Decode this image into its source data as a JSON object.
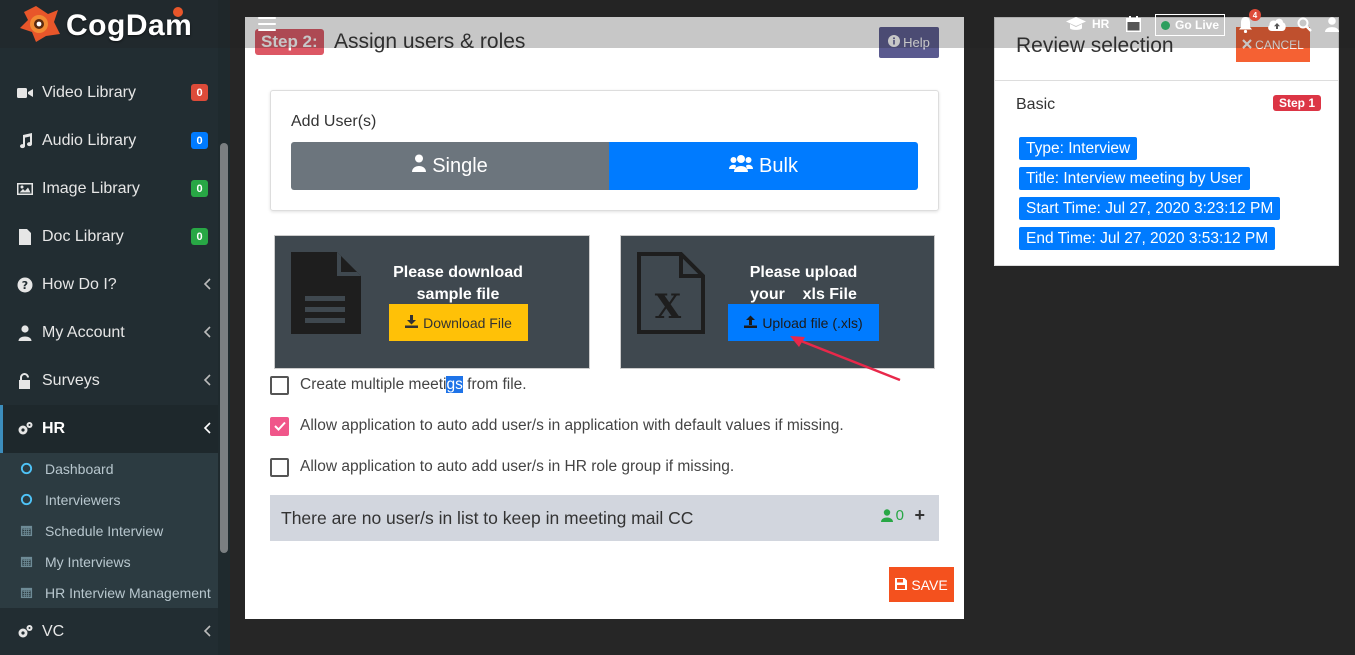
{
  "brand": {
    "logo_cog": "Cog",
    "logo_dam": "Dam"
  },
  "topbar": {
    "role_label": "HR",
    "golive_label": "Go Live",
    "notification_count": "4"
  },
  "sidebar": {
    "items": [
      {
        "label": "Video Library",
        "badge": "0",
        "badge_color": "#dd4b39"
      },
      {
        "label": "Audio Library",
        "badge": "0",
        "badge_color": "#007bff"
      },
      {
        "label": "Image Library",
        "badge": "0",
        "badge_color": "#28a745"
      },
      {
        "label": "Doc Library",
        "badge": "0",
        "badge_color": "#28a745"
      },
      {
        "label": "How Do I?"
      },
      {
        "label": "My Account"
      },
      {
        "label": "Surveys"
      },
      {
        "label": "HR"
      },
      {
        "label": "VC"
      }
    ],
    "hr_submenu": [
      {
        "label": "Dashboard"
      },
      {
        "label": "Interviewers"
      },
      {
        "label": "Schedule Interview"
      },
      {
        "label": "My Interviews"
      },
      {
        "label": "HR Interview Management"
      }
    ]
  },
  "main": {
    "step_badge": "Step 2:",
    "title": "Assign users & roles",
    "help_label": "Help",
    "add_user_label": "Add User(s)",
    "single_label": "Single",
    "bulk_label": "Bulk",
    "download_card": {
      "line1": "Please download",
      "line2": "sample file",
      "button": "Download File"
    },
    "upload_card": {
      "line1": "Please upload",
      "line2": "your    xls File",
      "button": "Upload file (.xls)"
    },
    "options": [
      {
        "pre": "Create multiple meeti",
        "sel": "gs",
        "post": " from file.",
        "checked": false
      },
      {
        "text": "Allow application to auto add user/s in application with default values if missing.",
        "checked": true
      },
      {
        "text": "Allow application to auto add user/s in HR role group if missing.",
        "checked": false
      }
    ],
    "cc_text": "There are no user/s in list to keep in meeting mail CC",
    "cc_count": "0",
    "cc_plus": "+",
    "save_label": "SAVE"
  },
  "review": {
    "title": "Review selection",
    "cancel_label": "CANCEL",
    "section_label": "Basic",
    "step_badge": "Step 1",
    "pills": [
      "Type: Interview",
      "Title: Interview meeting by User",
      "Start Time: Jul 27, 2020 3:23:12 PM",
      "End Time: Jul 27, 2020 3:53:12 PM"
    ]
  }
}
